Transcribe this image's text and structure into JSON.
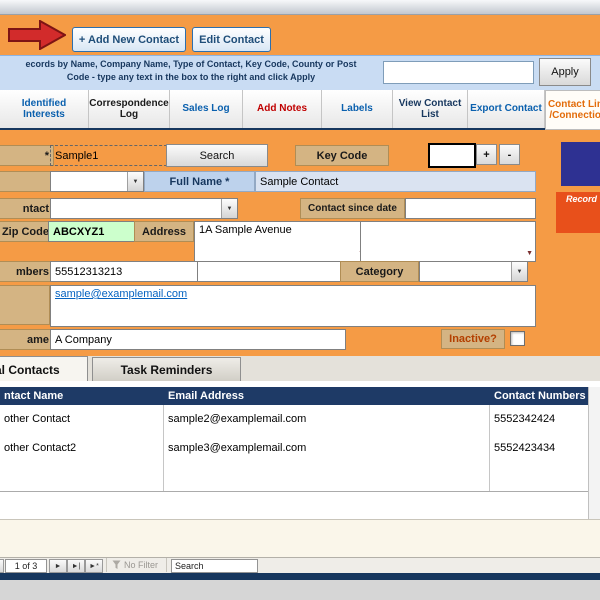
{
  "colors": {
    "form_background": "#F59B45",
    "label_tan": "#D4B483",
    "panel_blue": "#C9DCF3",
    "table_header_navy": "#1E3A66",
    "arrow_red": "#D22B2B",
    "record_badge_red": "#E8501B",
    "logo_blue": "#2E3192",
    "zip_highlight_green": "#CCFFCC",
    "link_blue": "#0563C1"
  },
  "icons": {
    "red_arrow": "right-arrow",
    "combo_arrow": "▼",
    "nav_next": "►",
    "nav_last": "►|",
    "nav_new": "►*",
    "funnel": "filter-funnel"
  },
  "toolbar": {
    "add_new_contact_label": "+ Add New Contact",
    "edit_contact_label": "Edit Contact"
  },
  "search_panel": {
    "instructions_line1": "ecords by Name, Company Name, Type of Contact, Key Code, County or Post",
    "instructions_line2": "Code - type any text in the box to the right and click Apply",
    "input_value": "",
    "apply_label": "Apply"
  },
  "nav_buttons": [
    {
      "label": "Identified Interests",
      "color": "#0A60AE"
    },
    {
      "label": "Correspondence Log",
      "color": "#1A1A1A"
    },
    {
      "label": "Sales Log",
      "color": "#0A60AE"
    },
    {
      "label": "Add Notes",
      "color": "#C00000"
    },
    {
      "label": "Labels",
      "color": "#0A60AE"
    },
    {
      "label": "View Contact List",
      "color": "#17375E"
    },
    {
      "label": "Export Contact",
      "color": "#0A60AE"
    },
    {
      "label": "Contact Links /Connections",
      "color": "#E36C0A"
    }
  ],
  "form": {
    "quick_search": {
      "label_fragment": "*",
      "value": "Sample1",
      "search_button": "Search"
    },
    "key_code": {
      "label": "Key Code",
      "value": "",
      "plus": "+",
      "minus": "-"
    },
    "title_field": {
      "label_fragment": "",
      "value": ""
    },
    "full_name": {
      "label": "Full Name *",
      "value": "Sample Contact"
    },
    "type_of_contact": {
      "label_fragment": "ntact",
      "value": ""
    },
    "contact_since": {
      "label": "Contact since date",
      "value": ""
    },
    "zip": {
      "label": "Zip Code",
      "value": "ABCXYZ1"
    },
    "address": {
      "label": "Address",
      "value": "1A Sample Avenue",
      "value2": ""
    },
    "numbers": {
      "label_fragment": "mbers",
      "value": "55512313213",
      "value2": ""
    },
    "category": {
      "label": "Category",
      "value": ""
    },
    "email": {
      "label_fragment": "",
      "value": "sample@examplemail.com"
    },
    "company": {
      "label_fragment": "ame",
      "value": "A Company"
    },
    "inactive": {
      "label": "Inactive?",
      "checked": false
    },
    "record_badge": "Record"
  },
  "subform": {
    "tabs": [
      {
        "label": "onal Contacts"
      },
      {
        "label": "Task Reminders"
      }
    ],
    "columns": [
      "ntact Name",
      "Email Address",
      "Contact Numbers"
    ],
    "rows": [
      {
        "name": "other Contact",
        "email": "sample2@examplemail.com",
        "numbers": "5552342424"
      },
      {
        "name": "other Contact2",
        "email": "sample3@examplemail.com",
        "numbers": "5552423434"
      },
      {
        "name": "",
        "email": "",
        "numbers": ""
      }
    ]
  },
  "record_nav": {
    "position": "1 of 3",
    "no_filter_label": "No Filter",
    "search_value": "Search"
  }
}
